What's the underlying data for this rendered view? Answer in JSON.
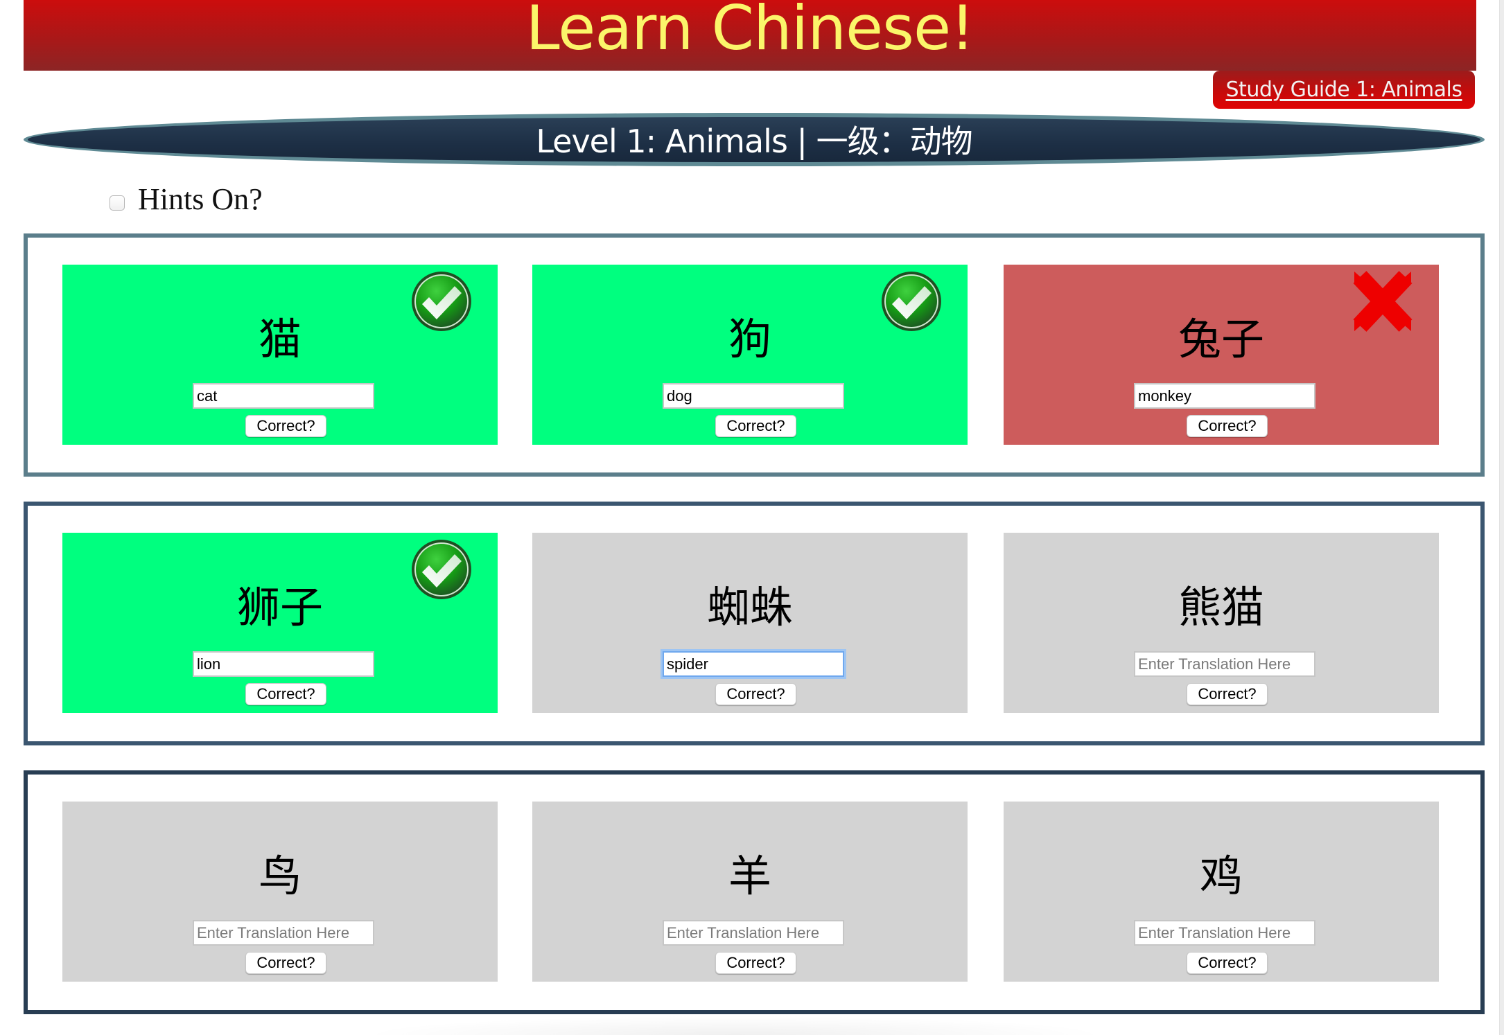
{
  "header": {
    "title": "Learn Chinese!",
    "colors": {
      "title_text": "#fbf56a",
      "background_top": "#cc0d0d",
      "background_bottom": "#8c2525"
    }
  },
  "study_guide_link": {
    "label": "Study Guide 1: Animals"
  },
  "level": {
    "title": "Level 1: Animals | 一级：动物"
  },
  "hints": {
    "label": "Hints On?",
    "checked": false
  },
  "status_colors": {
    "correct": "#00ff7f",
    "wrong": "#cd5c5c",
    "unanswered": "#d3d3d3"
  },
  "rows": [
    {
      "cards": [
        {
          "chinese": "猫",
          "input_value": "cat",
          "placeholder": "Enter Translation Here",
          "button": "Correct?",
          "status": "correct",
          "status_icon": "check-icon"
        },
        {
          "chinese": "狗",
          "input_value": "dog",
          "placeholder": "Enter Translation Here",
          "button": "Correct?",
          "status": "correct",
          "status_icon": "check-icon"
        },
        {
          "chinese": "兔子",
          "input_value": "monkey",
          "placeholder": "Enter Translation Here",
          "button": "Correct?",
          "status": "wrong",
          "status_icon": "x-icon"
        }
      ]
    },
    {
      "cards": [
        {
          "chinese": "狮子",
          "input_value": "lion",
          "placeholder": "Enter Translation Here",
          "button": "Correct?",
          "status": "correct",
          "status_icon": "check-icon"
        },
        {
          "chinese": "蜘蛛",
          "input_value": "spider",
          "placeholder": "Enter Translation Here",
          "button": "Correct?",
          "status": "unanswered",
          "status_icon": "",
          "focused": true
        },
        {
          "chinese": "熊猫",
          "input_value": "",
          "placeholder": "Enter Translation Here",
          "button": "Correct?",
          "status": "unanswered",
          "status_icon": ""
        }
      ]
    },
    {
      "cards": [
        {
          "chinese": "鸟",
          "input_value": "",
          "placeholder": "Enter Translation Here",
          "button": "Correct?",
          "status": "unanswered",
          "status_icon": ""
        },
        {
          "chinese": "羊",
          "input_value": "",
          "placeholder": "Enter Translation Here",
          "button": "Correct?",
          "status": "unanswered",
          "status_icon": ""
        },
        {
          "chinese": "鸡",
          "input_value": "",
          "placeholder": "Enter Translation Here",
          "button": "Correct?",
          "status": "unanswered",
          "status_icon": ""
        }
      ]
    }
  ]
}
